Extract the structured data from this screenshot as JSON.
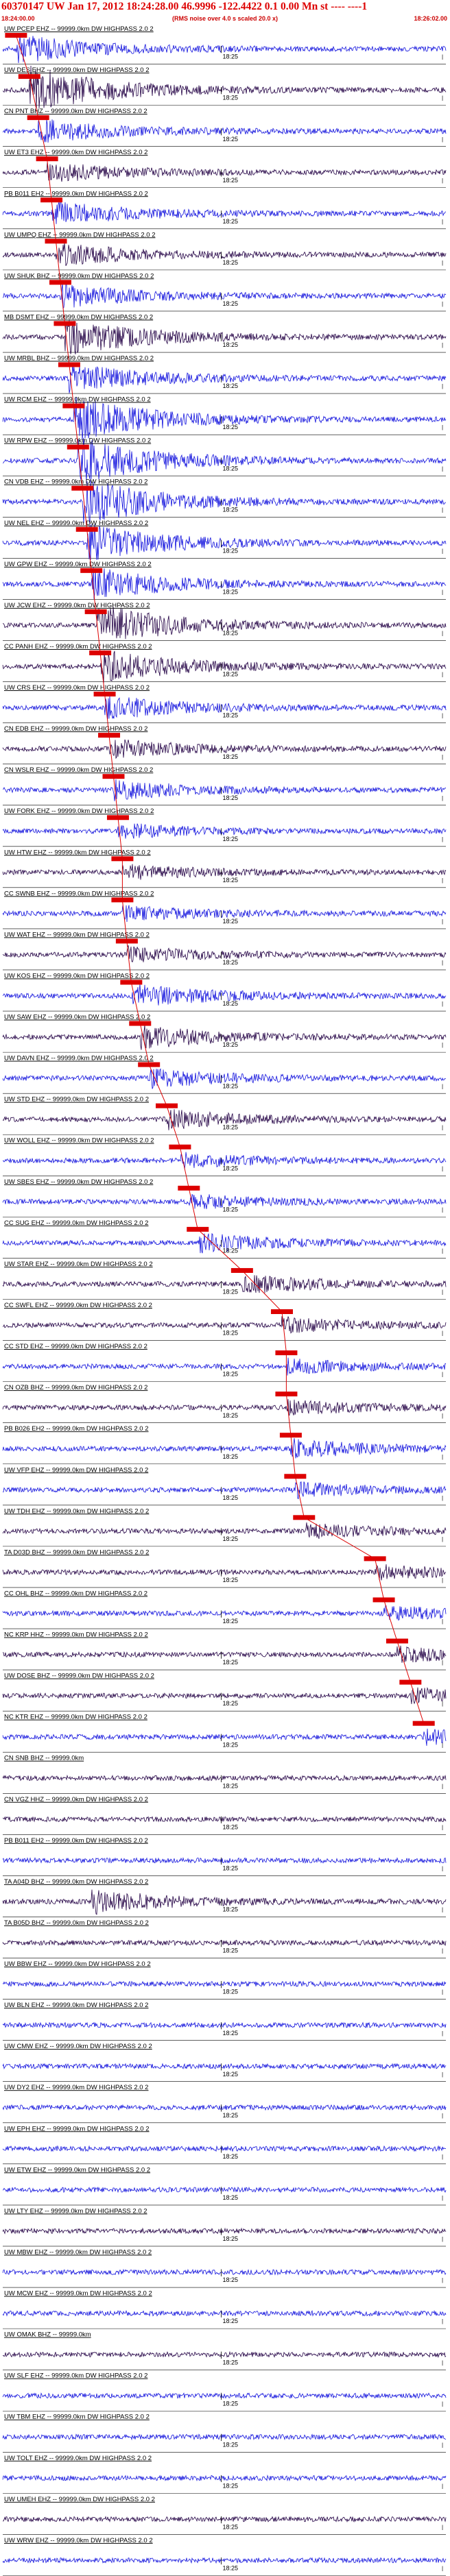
{
  "header": {
    "title": "60370147 UW Jan 17, 2012 18:24:28.00   46.9996 -122.4422  0.1 0.00 Mn st ---- ----1",
    "left_time": "18:24:00.00",
    "center_note": "(RMS noise over 4.0 s scaled 20.0 x)",
    "right_time": "18:26:02.00"
  },
  "colors": {
    "trace_a": "#1111dd",
    "trace_b": "#220044",
    "pick": "#dd0000",
    "axis": "#000000",
    "label": "#000000"
  },
  "chart_data": {
    "type": "line",
    "title": "60370147 UW Jan 17, 2012 18:24:28.00   46.9996 -122.4422  0.1 0.00 Mn st ---- ----1",
    "xlabel": "",
    "ylabel": "",
    "x_range": [
      "18:24:00.00",
      "18:26:02.00"
    ],
    "tick_label": "18:25",
    "channel_suffix": "HIGHPASS 2.0 2",
    "series": [
      {
        "name": "UW PCEP EHZ -- 99999.0km DW HIGHPASS 2.0 2",
        "amp": 0.6,
        "event": 0.03,
        "color": "a",
        "pick": true
      },
      {
        "name": "UW DES EHZ -- 99999.0km DW HIGHPASS 2.0 2",
        "amp": 1.0,
        "event": 0.06,
        "color": "b",
        "pick": true
      },
      {
        "name": "CN PNT BHZ -- 99999.0km DW HIGHPASS 2.0 2",
        "amp": 0.5,
        "event": 0.08,
        "color": "a",
        "pick": true
      },
      {
        "name": "UW ET3 EHZ -- 99999.0km DW HIGHPASS 2.0 2",
        "amp": 0.4,
        "event": 0.1,
        "color": "b",
        "pick": true
      },
      {
        "name": "PB B011 EH2 -- 99999.0km DW HIGHPASS 2.0 2",
        "amp": 0.5,
        "event": 0.11,
        "color": "a",
        "pick": true
      },
      {
        "name": "UW UMPQ EHZ -- 99999.0km DW HIGHPASS 2.0 2",
        "amp": 0.5,
        "event": 0.12,
        "color": "b",
        "pick": true
      },
      {
        "name": "UW SHUK BHZ -- 99999.0km DW HIGHPASS 2.0 2",
        "amp": 0.5,
        "event": 0.13,
        "color": "a",
        "pick": true
      },
      {
        "name": "MB DSMT EHZ -- 99999.0km DW HIGHPASS 2.0 2",
        "amp": 0.8,
        "event": 0.14,
        "color": "b",
        "pick": true
      },
      {
        "name": "UW MRBL BHZ -- 99999.0km DW HIGHPASS 2.0 2",
        "amp": 0.6,
        "event": 0.15,
        "color": "a",
        "pick": true
      },
      {
        "name": "UW RCM EHZ -- 99999.0km DW HIGHPASS 2.0 2",
        "amp": 1.0,
        "event": 0.16,
        "color": "a",
        "pick": true
      },
      {
        "name": "UW RPW EHZ -- 99999.0km DW HIGHPASS 2.0 2",
        "amp": 1.0,
        "event": 0.17,
        "color": "a",
        "pick": true
      },
      {
        "name": "CN VDB EHZ -- 99999.0km DW HIGHPASS 2.0 2",
        "amp": 1.0,
        "event": 0.18,
        "color": "a",
        "pick": true
      },
      {
        "name": "UW NEL EHZ -- 99999.0km DW HIGHPASS 2.0 2",
        "amp": 0.8,
        "event": 0.19,
        "color": "a",
        "pick": true
      },
      {
        "name": "UW GPW EHZ -- 99999.0km DW HIGHPASS 2.0 2",
        "amp": 0.7,
        "event": 0.2,
        "color": "a",
        "pick": true
      },
      {
        "name": "UW JCW EHZ -- 99999.0km DW HIGHPASS 2.0 2",
        "amp": 0.9,
        "event": 0.21,
        "color": "b",
        "pick": true
      },
      {
        "name": "CC PANH EHZ -- 99999.0km DW HIGHPASS 2.0 2",
        "amp": 0.7,
        "event": 0.22,
        "color": "b",
        "pick": true
      },
      {
        "name": "UW CRS EHZ -- 99999.0km DW HIGHPASS 2.0 2",
        "amp": 0.5,
        "event": 0.23,
        "color": "a",
        "pick": true
      },
      {
        "name": "CN EDB EHZ -- 99999.0km DW HIGHPASS 2.0 2",
        "amp": 0.4,
        "event": 0.24,
        "color": "b",
        "pick": true
      },
      {
        "name": "CN WSLR EHZ -- 99999.0km DW HIGHPASS 2.0 2",
        "amp": 0.4,
        "event": 0.25,
        "color": "a",
        "pick": true
      },
      {
        "name": "UW FORK EHZ -- 99999.0km DW HIGHPASS 2.0 2",
        "amp": 0.3,
        "event": 0.26,
        "color": "a",
        "pick": true
      },
      {
        "name": "UW HTW EHZ -- 99999.0km DW HIGHPASS 2.0 2",
        "amp": 0.3,
        "event": 0.27,
        "color": "b",
        "pick": true
      },
      {
        "name": "CC SWNB EHZ -- 99999.0km DW HIGHPASS 2.0 2",
        "amp": 0.3,
        "event": 0.27,
        "color": "a",
        "pick": true
      },
      {
        "name": "UW WAT EHZ -- 99999.0km DW HIGHPASS 2.0 2",
        "amp": 0.3,
        "event": 0.28,
        "color": "b",
        "pick": true
      },
      {
        "name": "UW KOS EHZ -- 99999.0km DW HIGHPASS 2.0 2",
        "amp": 0.5,
        "event": 0.29,
        "color": "a",
        "pick": true
      },
      {
        "name": "UW SAW EHZ -- 99999.0km DW HIGHPASS 2.0 2",
        "amp": 0.5,
        "event": 0.31,
        "color": "b",
        "pick": true
      },
      {
        "name": "UW DAVN EHZ -- 99999.0km DW HIGHPASS 2.0 2",
        "amp": 0.4,
        "event": 0.33,
        "color": "a",
        "pick": true
      },
      {
        "name": "UW STD EHZ -- 99999.0km DW HIGHPASS 2.0 2",
        "amp": 0.4,
        "event": 0.37,
        "color": "b",
        "pick": true
      },
      {
        "name": "UW WOLL EHZ -- 99999.0km DW HIGHPASS 2.0 2",
        "amp": 0.3,
        "event": 0.4,
        "color": "a",
        "pick": true
      },
      {
        "name": "UW SBES EHZ -- 99999.0km DW HIGHPASS 2.0 2",
        "amp": 0.3,
        "event": 0.42,
        "color": "a",
        "pick": true
      },
      {
        "name": "CC SUG EHZ -- 99999.0km DW HIGHPASS 2.0 2",
        "amp": 0.4,
        "event": 0.44,
        "color": "a",
        "pick": true
      },
      {
        "name": "UW STAR EHZ -- 99999.0km DW HIGHPASS 2.0 2",
        "amp": 0.4,
        "event": 0.54,
        "color": "b",
        "pick": true
      },
      {
        "name": "CC SWFL EHZ -- 99999.0km DW HIGHPASS 2.0 2",
        "amp": 0.3,
        "event": 0.63,
        "color": "b",
        "pick": true
      },
      {
        "name": "CC STD EHZ -- 99999.0km DW HIGHPASS 2.0 2",
        "amp": 0.3,
        "event": 0.64,
        "color": "a",
        "pick": true
      },
      {
        "name": "CN OZB BHZ -- 99999.0km DW HIGHPASS 2.0 2",
        "amp": 0.3,
        "event": 0.64,
        "color": "b",
        "pick": true
      },
      {
        "name": "PB B026 EH2 -- 99999.0km DW HIGHPASS 2.0 2",
        "amp": 0.4,
        "event": 0.65,
        "color": "a",
        "pick": true
      },
      {
        "name": "UW VFP EHZ -- 99999.0km DW HIGHPASS 2.0 2",
        "amp": 0.3,
        "event": 0.66,
        "color": "a",
        "pick": true
      },
      {
        "name": "UW TDH EHZ -- 99999.0km DW HIGHPASS 2.0 2",
        "amp": 0.3,
        "event": 0.68,
        "color": "b",
        "pick": true
      },
      {
        "name": "TA D03D BHZ -- 99999.0km DW HIGHPASS 2.0 2",
        "amp": 0.3,
        "event": 0.84,
        "color": "b",
        "pick": true
      },
      {
        "name": "CC OHL BHZ -- 99999.0km DW HIGHPASS 2.0 2",
        "amp": 0.3,
        "event": 0.86,
        "color": "a",
        "pick": true
      },
      {
        "name": "NC KRP HHZ -- 99999.0km DW HIGHPASS 2.0 2",
        "amp": 0.3,
        "event": 0.89,
        "color": "b",
        "pick": true
      },
      {
        "name": "UW DOSE BHZ -- 99999.0km DW HIGHPASS 2.0 2",
        "amp": 0.3,
        "event": 0.92,
        "color": "b",
        "pick": true
      },
      {
        "name": "NC KTR EHZ -- 99999.0km DW HIGHPASS 2.0 2",
        "amp": 0.3,
        "event": 0.95,
        "color": "a",
        "pick": true
      },
      {
        "name": "CN SNB BHZ -- 99999.0km",
        "amp": 0.2,
        "event": null,
        "color": "b",
        "pick": false
      },
      {
        "name": "CN VGZ HHZ -- 99999.0km DW HIGHPASS 2.0 2",
        "amp": 0.2,
        "event": null,
        "color": "b",
        "pick": false
      },
      {
        "name": "PB B011 EH2 -- 99999.0km DW HIGHPASS 2.0 2",
        "amp": 0.3,
        "event": null,
        "color": "a",
        "pick": false
      },
      {
        "name": "TA A04D BHZ -- 99999.0km DW HIGHPASS 2.0 2",
        "amp": 0.5,
        "event": 0.2,
        "color": "b",
        "pick": false
      },
      {
        "name": "TA B05D BHZ -- 99999.0km DW HIGHPASS 2.0 2",
        "amp": 0.3,
        "event": null,
        "color": "b",
        "pick": false
      },
      {
        "name": "UW BBW EHZ -- 99999.0km DW HIGHPASS 2.0 2",
        "amp": 0.3,
        "event": null,
        "color": "a",
        "pick": false
      },
      {
        "name": "UW BLN EHZ -- 99999.0km DW HIGHPASS 2.0 2",
        "amp": 0.3,
        "event": null,
        "color": "a",
        "pick": false
      },
      {
        "name": "UW CMW EHZ -- 99999.0km DW HIGHPASS 2.0 2",
        "amp": 0.3,
        "event": null,
        "color": "a",
        "pick": false
      },
      {
        "name": "UW DY2 EHZ -- 99999.0km DW HIGHPASS 2.0 2",
        "amp": 0.3,
        "event": null,
        "color": "a",
        "pick": false
      },
      {
        "name": "UW EPH EHZ -- 99999.0km DW HIGHPASS 2.0 2",
        "amp": 0.3,
        "event": null,
        "color": "a",
        "pick": false
      },
      {
        "name": "UW ETW EHZ -- 99999.0km DW HIGHPASS 2.0 2",
        "amp": 0.3,
        "event": null,
        "color": "a",
        "pick": false
      },
      {
        "name": "UW LTY EHZ -- 99999.0km DW HIGHPASS 2.0 2",
        "amp": 0.3,
        "event": null,
        "color": "b",
        "pick": false
      },
      {
        "name": "UW MBW EHZ -- 99999.0km DW HIGHPASS 2.0 2",
        "amp": 0.3,
        "event": null,
        "color": "a",
        "pick": false
      },
      {
        "name": "UW MCW EHZ -- 99999.0km DW HIGHPASS 2.0 2",
        "amp": 0.3,
        "event": null,
        "color": "a",
        "pick": false
      },
      {
        "name": "UW OMAK BHZ -- 99999.0km",
        "amp": 0.2,
        "event": null,
        "color": "b",
        "pick": false
      },
      {
        "name": "UW SLF EHZ -- 99999.0km DW HIGHPASS 2.0 2",
        "amp": 0.3,
        "event": null,
        "color": "a",
        "pick": false
      },
      {
        "name": "UW TBM EHZ -- 99999.0km DW HIGHPASS 2.0 2",
        "amp": 0.3,
        "event": null,
        "color": "a",
        "pick": false
      },
      {
        "name": "UW TOLT EHZ -- 99999.0km DW HIGHPASS 2.0 2",
        "amp": 0.3,
        "event": null,
        "color": "a",
        "pick": false
      },
      {
        "name": "UW UMEH EHZ -- 99999.0km DW HIGHPASS 2.0 2",
        "amp": 0.3,
        "event": null,
        "color": "b",
        "pick": false
      },
      {
        "name": "UW WRW EHZ -- 99999.0km DW HIGHPASS 2.0 2",
        "amp": 0.3,
        "event": null,
        "color": "a",
        "pick": false
      }
    ]
  }
}
